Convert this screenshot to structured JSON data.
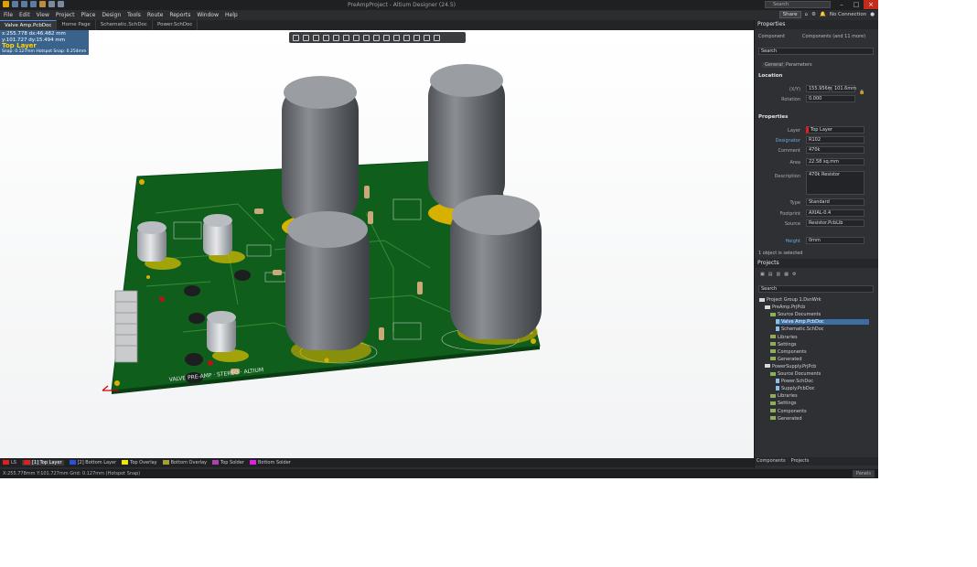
{
  "titlebar": {
    "title": "PreAmpProject - Altium Designer (24.5)",
    "search": "Search"
  },
  "menubar": {
    "items": [
      "File",
      "Edit",
      "View",
      "Project",
      "Place",
      "Design",
      "Tools",
      "Route",
      "Reports",
      "Window",
      "Help"
    ],
    "share": "Share",
    "no_connection": "No Connection"
  },
  "tabs": [
    {
      "label": "Valve Amp.PcbDoc",
      "active": true
    },
    {
      "label": "Home Page",
      "active": false
    },
    {
      "label": "Schematic.SchDoc",
      "active": false
    },
    {
      "label": "Power.SchDoc",
      "active": false
    }
  ],
  "coord": {
    "line1": "x:255.778   dx:46.482 mm",
    "line2": "y:101.727   dy:15.494 mm",
    "layer": "Top Layer",
    "line4": "Snap: 0.127mm Hotspot Snap: 0.254mm"
  },
  "silkscreen": "VALVE PRE-AMP · STEREO · ALTIUM",
  "layers": [
    {
      "label": "LS",
      "color": "#e02020",
      "active": false
    },
    {
      "label": "[1] Top Layer",
      "color": "#e02020",
      "active": true
    },
    {
      "label": "[2] Bottom Layer",
      "color": "#2b4fe0",
      "active": false
    },
    {
      "label": "Top Overlay",
      "color": "#f2e600",
      "active": false
    },
    {
      "label": "Bottom Overlay",
      "color": "#a6a030",
      "active": false
    },
    {
      "label": "Top Solder",
      "color": "#b040b0",
      "active": false
    },
    {
      "label": "Bottom Solder",
      "color": "#e020e0",
      "active": false
    }
  ],
  "status": {
    "text": "X:255.778mm Y:101.727mm  Grid: 0.127mm  (Hotspot Snap)",
    "panels": "Panels"
  },
  "properties": {
    "header": "Properties",
    "component_label": "Component",
    "filter_label": "Components (and 11 more)",
    "search": "Search",
    "tabs": [
      "General",
      "Parameters"
    ],
    "location_header": "Location",
    "x_y_label": "(X/Y)",
    "x_value": "155.956mm",
    "y_value": "101.6mm",
    "rotation_label": "Rotation",
    "rotation_value": "0.000",
    "props_header": "Properties",
    "layer_label": "Layer",
    "layer_value": "Top Layer",
    "designator_label": "Designator",
    "designator_value": "R102",
    "comment_label": "Comment",
    "comment_value": "470k",
    "area_label": "Area",
    "area_value": "22.58 sq.mm",
    "description_label": "Description",
    "description_value": "470k Resistor",
    "type_label": "Type",
    "type_value": "Standard",
    "height_label": "Height",
    "height_value": "0mm",
    "footprint_label": "Footprint",
    "footprint_value": "AXIAL-0.4",
    "library_label": "Source",
    "library_value": "Resistor.PcbLib",
    "selection": "1 object is selected"
  },
  "projects": {
    "header": "Projects",
    "search": "Search",
    "tree": [
      {
        "label": "Project Group 1.DsnWrk",
        "indent": 0,
        "kind": "group",
        "selected": false
      },
      {
        "label": "PreAmp.PrjPcb",
        "indent": 1,
        "kind": "project",
        "selected": false
      },
      {
        "label": "Source Documents",
        "indent": 2,
        "kind": "folder",
        "selected": false
      },
      {
        "label": "Valve Amp.PcbDoc",
        "indent": 3,
        "kind": "doc",
        "selected": true
      },
      {
        "label": "Schematic.SchDoc",
        "indent": 3,
        "kind": "doc",
        "selected": false
      },
      {
        "label": "Libraries",
        "indent": 2,
        "kind": "folder",
        "selected": false
      },
      {
        "label": "Settings",
        "indent": 2,
        "kind": "folder",
        "selected": false
      },
      {
        "label": "Components",
        "indent": 2,
        "kind": "folder",
        "selected": false
      },
      {
        "label": "Generated",
        "indent": 2,
        "kind": "folder",
        "selected": false
      },
      {
        "label": "PowerSupply.PrjPcb",
        "indent": 1,
        "kind": "project",
        "selected": false
      },
      {
        "label": "Source Documents",
        "indent": 2,
        "kind": "folder",
        "selected": false
      },
      {
        "label": "Power.SchDoc",
        "indent": 3,
        "kind": "doc",
        "selected": false
      },
      {
        "label": "Supply.PcbDoc",
        "indent": 3,
        "kind": "doc",
        "selected": false
      },
      {
        "label": "Libraries",
        "indent": 2,
        "kind": "folder",
        "selected": false
      },
      {
        "label": "Settings",
        "indent": 2,
        "kind": "folder",
        "selected": false
      },
      {
        "label": "Components",
        "indent": 2,
        "kind": "folder",
        "selected": false
      },
      {
        "label": "Generated",
        "indent": 2,
        "kind": "folder",
        "selected": false
      }
    ]
  },
  "bottom_tabs": [
    "Components",
    "Projects"
  ]
}
